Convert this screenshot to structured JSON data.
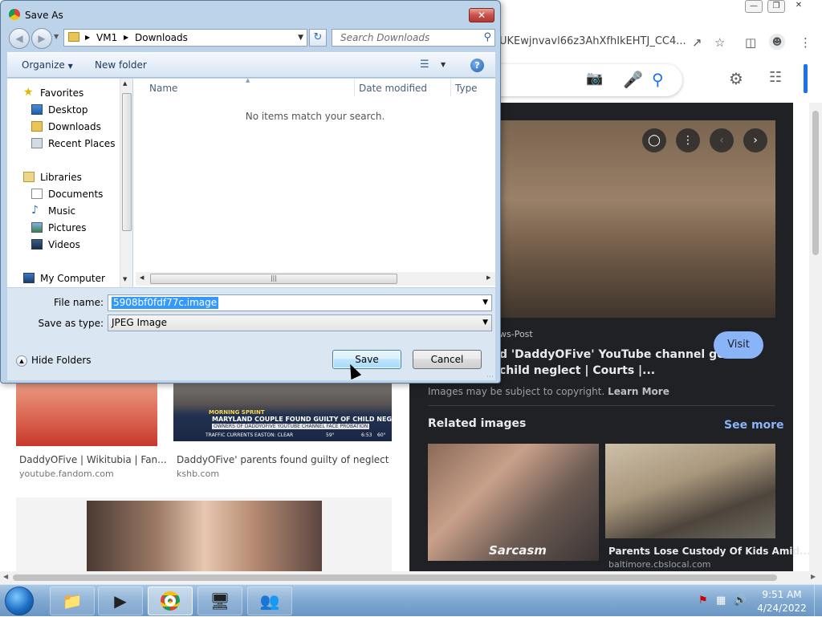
{
  "browser": {
    "url_text": "UKEwjnvavl66z3AhXfhIkEHTJ_CC4...",
    "window_controls": [
      "minimize",
      "restore",
      "close"
    ],
    "results": [
      {
        "title": "DaddyOFive | Wikitubia | Fan...",
        "source": "youtube.fandom.com"
      },
      {
        "title": "DaddyOFive' parents found guilty of neglect",
        "source": "kshb.com"
      }
    ],
    "news_banner": {
      "headline": "MARYLAND COUPLE FOUND GUILTY OF CHILD NEGLECT",
      "subline": "OWNERS OF DADDYOFIVE YOUTUBE CHANNEL FACE PROBATION",
      "ticker": "TRAFFIC  CURRENTS  EASTON:  CLEAR",
      "temp": "59°",
      "time": "6:53",
      "temp2": "60°",
      "tag": "MORNING SPRINT"
    },
    "panel": {
      "source": "ws-Post",
      "title_line1": "d 'DaddyOFive' YouTube channel gets",
      "title_line2": "child neglect | Courts |...",
      "visit_label": "Visit",
      "copyright_text": "Images may be subject to copyright.",
      "learn_more": "Learn More",
      "related_heading": "Related images",
      "see_more": "See more",
      "related": [
        {
          "caption": "",
          "source": ""
        },
        {
          "caption": "Parents Lose Custody Of Kids Amid...",
          "source": "baltimore.cbslocal.com"
        }
      ],
      "related_overlay": "Sarcasm"
    }
  },
  "dialog": {
    "title": "Save As",
    "breadcrumb": [
      "VM1",
      "Downloads"
    ],
    "search_placeholder": "Search Downloads",
    "toolbar": {
      "organize": "Organize",
      "new_folder": "New folder"
    },
    "nav": {
      "favorites": "Favorites",
      "desktop": "Desktop",
      "downloads": "Downloads",
      "recent": "Recent Places",
      "libraries": "Libraries",
      "documents": "Documents",
      "music": "Music",
      "pictures": "Pictures",
      "videos": "Videos",
      "computer": "My Computer"
    },
    "columns": {
      "name": "Name",
      "date_modified": "Date modified",
      "type": "Type"
    },
    "empty_message": "No items match your search.",
    "file_name_label": "File name:",
    "file_name_value": "5908bf0fdf77c.image",
    "save_type_label": "Save as type:",
    "save_type_value": "JPEG Image",
    "hide_folders": "Hide Folders",
    "save_label": "Save",
    "cancel_label": "Cancel"
  },
  "taskbar": {
    "time": "9:51 AM",
    "date": "4/24/2022"
  },
  "colors": {
    "accent": "#1a73e8",
    "dialog_frame": "#bcd3ea",
    "panel_bg": "#202124",
    "link_blue": "#8ab4f8",
    "selection": "#3399ff"
  }
}
